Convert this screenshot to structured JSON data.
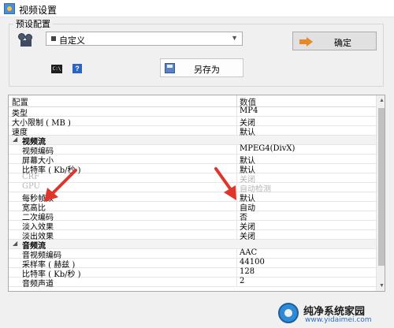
{
  "window": {
    "title": "视频设置"
  },
  "preset": {
    "group_label": "预设配置",
    "selected": "自定义",
    "ok_label": "确定",
    "save_as_label": "另存为",
    "cmd_icon_text": "C:\\"
  },
  "grid": {
    "col_setting": "配置",
    "col_value": "数值",
    "rows": [
      {
        "label": "类型",
        "value": "MP4"
      },
      {
        "label": "大小限制 ( MB )",
        "value": "关闭"
      },
      {
        "label": "速度",
        "value": "默认"
      },
      {
        "label": "视频流",
        "value": ""
      },
      {
        "label": "视频编码",
        "value": "MPEG4(DivX)"
      },
      {
        "label": "屏幕大小",
        "value": "默认"
      },
      {
        "label": "比特率 ( Kb/秒 )",
        "value": "默认"
      },
      {
        "label": "CRF",
        "value": "关闭"
      },
      {
        "label": "GPU",
        "value": "自动检测"
      },
      {
        "label": "每秒帧数",
        "value": "默认"
      },
      {
        "label": "宽高比",
        "value": "自动"
      },
      {
        "label": "二次编码",
        "value": "否"
      },
      {
        "label": "淡入效果",
        "value": "关闭"
      },
      {
        "label": "淡出效果",
        "value": "关闭"
      },
      {
        "label": "音频流",
        "value": ""
      },
      {
        "label": "音视频编码",
        "value": "AAC"
      },
      {
        "label": "采样率 ( 赫兹 )",
        "value": "44100"
      },
      {
        "label": "比特率 ( Kb/秒 )",
        "value": "128"
      },
      {
        "label": "音频声道",
        "value": "2"
      }
    ]
  },
  "watermark": {
    "title": "纯净系统家园",
    "url": "www.yidaimei.com"
  },
  "colors": {
    "arrow": "#e0352b",
    "section_bg": "#f3f3f3",
    "disabled_text": "#b5b5b5"
  }
}
